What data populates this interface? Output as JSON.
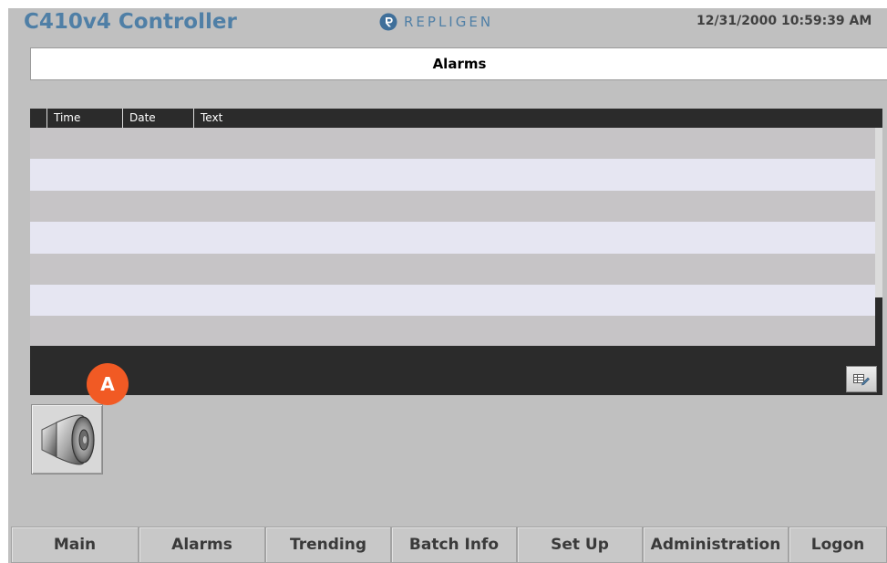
{
  "header": {
    "app_title": "C410v4 Controller",
    "brand": "REPLIGEN",
    "datetime": "12/31/2000 10:59:39 AM"
  },
  "page": {
    "title": "Alarms"
  },
  "alarm_table": {
    "columns": [
      "Time",
      "Date",
      "Text"
    ],
    "rows": []
  },
  "callout": {
    "label": "A",
    "color": "#f15a24"
  },
  "icons": {
    "brand_logo": "repligen-logo-icon",
    "table_config": "table-edit-icon",
    "speaker": "speaker-icon"
  },
  "nav": {
    "tabs": [
      {
        "label": "Main"
      },
      {
        "label": "Alarms"
      },
      {
        "label": "Trending"
      },
      {
        "label": "Batch Info"
      },
      {
        "label": "Set Up"
      },
      {
        "label": "Administration"
      },
      {
        "label": "Logon"
      }
    ]
  },
  "colors": {
    "brand_blue": "#4f7fa6",
    "panel_bg": "#c0c0c0",
    "table_dark": "#2b2b2b",
    "row_odd": "#c6c4c6",
    "row_even": "#e6e6f2"
  }
}
